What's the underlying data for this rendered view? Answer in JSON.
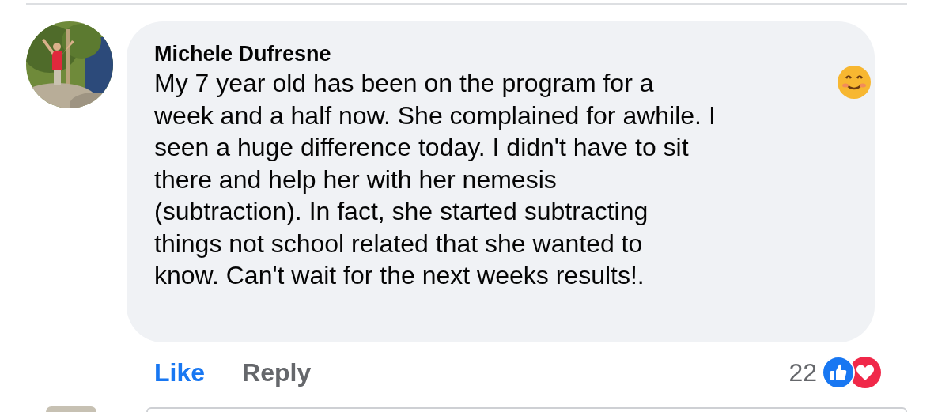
{
  "comment": {
    "author": "Michele Dufresne",
    "text": "My 7 year old has been on the program for a\nweek and a half now. She complained for awhile. I\nseen a huge difference today. I didn't have to sit\nthere and help her with her nemesis\n(subtraction). In fact, she started subtracting\nthings not school related that she wanted to\nknow. Can't wait for the next weeks results!.",
    "actions": [
      {
        "label": "Like",
        "selected": true
      },
      {
        "label": "Reply",
        "selected": false
      }
    ],
    "reaction_count": "22"
  }
}
